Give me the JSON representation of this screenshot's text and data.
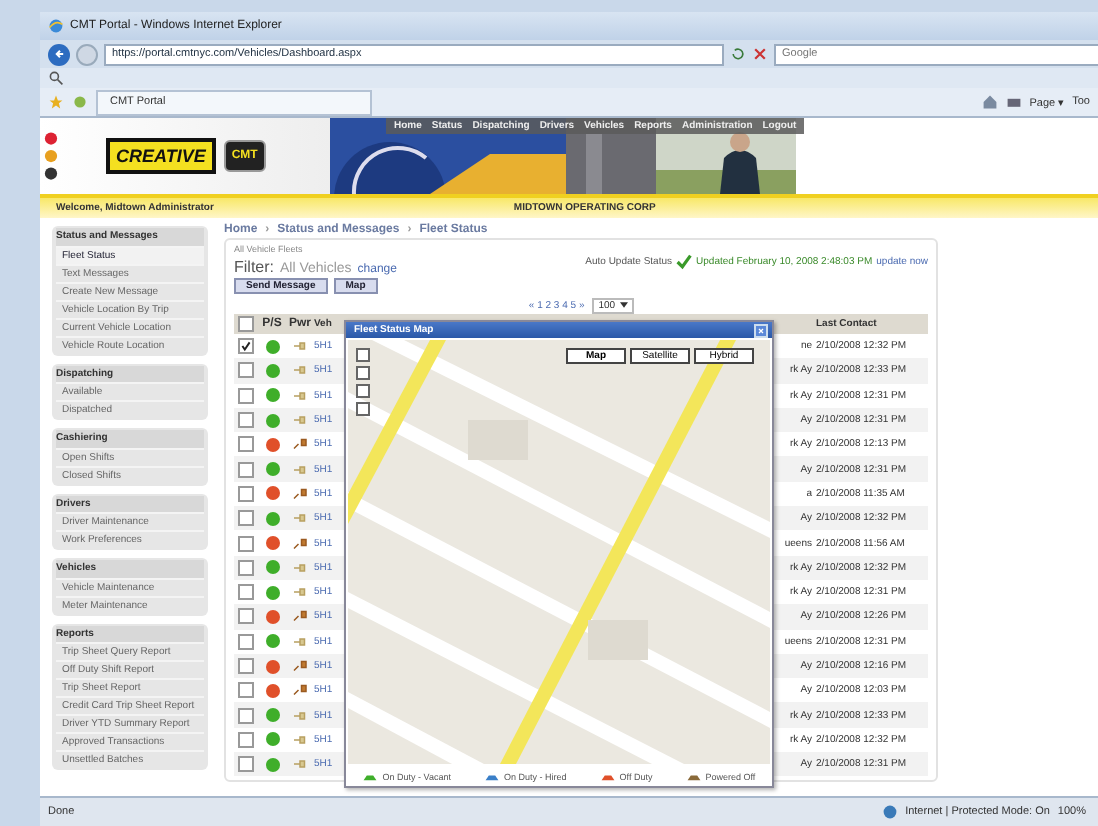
{
  "window": {
    "title": "CMT Portal - Windows Internet Explorer"
  },
  "browser": {
    "address": "https://portal.cmtnyc.com/Vehicles/Dashboard.aspx",
    "search_placeholder": "Google",
    "tab": "CMT Portal",
    "commands": [
      "Page ▾",
      "Too"
    ]
  },
  "site": {
    "logo_word": "CREATIVE",
    "logo_badge": "CMT",
    "nav": [
      "Home",
      "Status",
      "Dispatching",
      "Drivers",
      "Vehicles",
      "Reports",
      "Administration",
      "Logout"
    ],
    "welcome": "Welcome, Midtown Administrator",
    "company": "MIDTOWN OPERATING CORP"
  },
  "sidebar": [
    {
      "heading": "Status and Messages",
      "items": [
        {
          "label": "Fleet Status",
          "selected": true
        },
        {
          "label": "Text Messages",
          "selected": false
        },
        {
          "label": "Create New Message",
          "selected": false
        },
        {
          "label": "Vehicle Location By Trip",
          "selected": false
        },
        {
          "label": "Current Vehicle Location",
          "selected": false
        },
        {
          "label": "Vehicle Route Location",
          "selected": false
        }
      ]
    },
    {
      "heading": "Dispatching",
      "items": [
        {
          "label": "Available",
          "selected": false
        },
        {
          "label": "Dispatched",
          "selected": false
        }
      ]
    },
    {
      "heading": "Cashiering",
      "items": [
        {
          "label": "Open Shifts",
          "selected": false
        },
        {
          "label": "Closed Shifts",
          "selected": false
        }
      ]
    },
    {
      "heading": "Drivers",
      "items": [
        {
          "label": "Driver Maintenance",
          "selected": false
        },
        {
          "label": "Work Preferences",
          "selected": false
        }
      ]
    },
    {
      "heading": "Vehicles",
      "items": [
        {
          "label": "Vehicle Maintenance",
          "selected": false
        },
        {
          "label": "Meter Maintenance",
          "selected": false
        }
      ]
    },
    {
      "heading": "Reports",
      "items": [
        {
          "label": "Trip Sheet Query Report",
          "selected": false
        },
        {
          "label": "Off Duty Shift Report",
          "selected": false
        },
        {
          "label": "Trip Sheet Report",
          "selected": false
        },
        {
          "label": "Credit Card Trip Sheet Report",
          "selected": false
        },
        {
          "label": "Driver YTD Summary Report",
          "selected": false
        },
        {
          "label": "Approved Transactions",
          "selected": false
        },
        {
          "label": "Unsettled Batches",
          "selected": false
        }
      ]
    }
  ],
  "breadcrumb": {
    "separator": "›",
    "links": [
      "Home",
      "Status and Messages",
      "Fleet Status"
    ]
  },
  "fleet": {
    "scope": "All Vehicle Fleets",
    "filter_label": "Filter:",
    "filter_value": "All Vehicles",
    "filter_link": "change",
    "buttons": [
      "Send Message",
      "Map"
    ],
    "auto_update_label": "Auto Update Status",
    "updated": "Updated February 10, 2008 2:48:03 PM",
    "update_link": "update now",
    "pager": "« 1 2 3 4 5 »",
    "page_size": "100"
  },
  "table": {
    "all_checked": false,
    "columns": [
      "P/S",
      "Pwr",
      "Veh",
      "Last Contact"
    ],
    "rows": [
      {
        "checked": true,
        "color": "#3fae2a",
        "powered": true,
        "vehicle": "5H1",
        "column_5": "ne",
        "last_contact": "2/10/2008 12:32 PM"
      },
      {
        "checked": false,
        "color": "#3fae2a",
        "powered": true,
        "vehicle": "5H1",
        "column_5": "rk Ay",
        "last_contact": "2/10/2008 12:33 PM"
      },
      {
        "checked": false,
        "color": "#3fae2a",
        "powered": true,
        "vehicle": "5H1",
        "column_5": "rk Ay",
        "last_contact": "2/10/2008 12:31 PM"
      },
      {
        "checked": false,
        "color": "#3fae2a",
        "powered": true,
        "vehicle": "5H1",
        "column_5": "Ay",
        "last_contact": "2/10/2008 12:31 PM"
      },
      {
        "checked": false,
        "color": "#e0502a",
        "powered": false,
        "vehicle": "5H1",
        "column_5": "rk Ay",
        "last_contact": "2/10/2008 12:13 PM"
      },
      {
        "checked": false,
        "color": "#3fae2a",
        "powered": true,
        "vehicle": "5H1",
        "column_5": "Ay",
        "last_contact": "2/10/2008 12:31 PM"
      },
      {
        "checked": false,
        "color": "#e0502a",
        "powered": false,
        "vehicle": "5H1",
        "column_5": "a",
        "last_contact": "2/10/2008 11:35 AM"
      },
      {
        "checked": false,
        "color": "#3fae2a",
        "powered": true,
        "vehicle": "5H1",
        "column_5": "Ay",
        "last_contact": "2/10/2008 12:32 PM"
      },
      {
        "checked": false,
        "color": "#e0502a",
        "powered": false,
        "vehicle": "5H1",
        "column_5": "ueens",
        "last_contact": "2/10/2008 11:56 AM"
      },
      {
        "checked": false,
        "color": "#3fae2a",
        "powered": true,
        "vehicle": "5H1",
        "column_5": "rk Ay",
        "last_contact": "2/10/2008 12:32 PM"
      },
      {
        "checked": false,
        "color": "#3fae2a",
        "powered": true,
        "vehicle": "5H1",
        "column_5": "rk Ay",
        "last_contact": "2/10/2008 12:31 PM"
      },
      {
        "checked": false,
        "color": "#e0502a",
        "powered": false,
        "vehicle": "5H1",
        "column_5": "Ay",
        "last_contact": "2/10/2008 12:26 PM"
      },
      {
        "checked": false,
        "color": "#3fae2a",
        "powered": true,
        "vehicle": "5H1",
        "column_5": "ueens",
        "last_contact": "2/10/2008 12:31 PM"
      },
      {
        "checked": false,
        "color": "#e0502a",
        "powered": false,
        "vehicle": "5H1",
        "column_5": "Ay",
        "last_contact": "2/10/2008 12:16 PM"
      },
      {
        "checked": false,
        "color": "#e0502a",
        "powered": false,
        "vehicle": "5H1",
        "column_5": "Ay",
        "last_contact": "2/10/2008 12:03 PM"
      },
      {
        "checked": false,
        "color": "#3fae2a",
        "powered": true,
        "vehicle": "5H1",
        "column_5": "rk Ay",
        "last_contact": "2/10/2008 12:33 PM"
      },
      {
        "checked": false,
        "color": "#3fae2a",
        "powered": true,
        "vehicle": "5H1",
        "column_5": "rk Ay",
        "last_contact": "2/10/2008 12:32 PM"
      },
      {
        "checked": false,
        "color": "#3fae2a",
        "powered": true,
        "vehicle": "5H1",
        "column_5": "Ay",
        "last_contact": "2/10/2008 12:31 PM"
      }
    ]
  },
  "map_window": {
    "title": "Fleet Status Map",
    "map_types": [
      {
        "label": "Map",
        "selected": true
      },
      {
        "label": "Satellite",
        "selected": false
      },
      {
        "label": "Hybrid",
        "selected": false
      }
    ],
    "legend": [
      {
        "label": "On Duty - Vacant",
        "color": "#3fae2a"
      },
      {
        "label": "On Duty - Hired",
        "color": "#3a7fc8"
      },
      {
        "label": "Off Duty",
        "color": "#e0502a"
      },
      {
        "label": "Powered Off",
        "color": "#8a6a3a"
      }
    ]
  },
  "status_bar": {
    "text": "Done",
    "zone": "Internet | Protected Mode: On",
    "zoom": "100%"
  }
}
